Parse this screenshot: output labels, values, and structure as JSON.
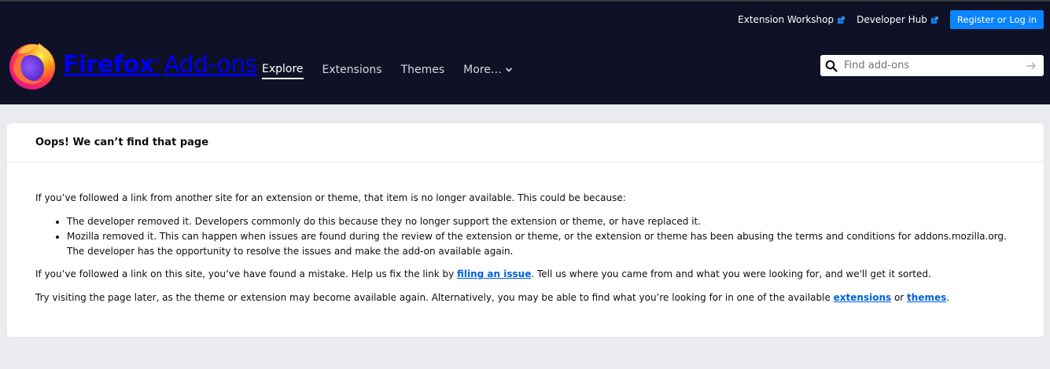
{
  "header": {
    "top_links": [
      {
        "label": "Extension Workshop",
        "icon": "external-link-icon"
      },
      {
        "label": "Developer Hub",
        "icon": "external-link-icon"
      }
    ],
    "register_label": "Register or Log in",
    "logo": {
      "brand": "Firefox",
      "trademark": "®",
      "product": "Add-ons"
    },
    "nav": [
      {
        "label": "Explore",
        "active": true
      },
      {
        "label": "Extensions",
        "active": false
      },
      {
        "label": "Themes",
        "active": false
      },
      {
        "label": "More…",
        "active": false
      }
    ],
    "search": {
      "placeholder": "Find add-ons",
      "value": ""
    }
  },
  "card": {
    "title": "Oops! We can’t find that page",
    "intro": "If you’ve followed a link from another site for an extension or theme, that item is no longer available. This could be because:",
    "reasons": [
      "The developer removed it. Developers commonly do this because they no longer support the extension or theme, or have replaced it.",
      "Mozilla removed it. This can happen when issues are found during the review of the extension or theme, or the extension or theme has been abusing the terms and conditions for addons.mozilla.org. The developer has the opportunity to resolve the issues and make the add-on available again."
    ],
    "para2": {
      "before": "If you’ve followed a link on this site, you’ve have found a mistake. Help us fix the link by ",
      "link": "filing an issue",
      "after": ". Tell us where you came from and what you were looking for, and we'll get it sorted."
    },
    "para3": {
      "before": "Try visiting the page later, as the theme or extension may become available again. Alternatively, you may be able to find what you’re looking for in one of the available ",
      "link1": "extensions",
      "middle": " or ",
      "link2": "themes",
      "after": "."
    }
  },
  "colors": {
    "header_bg": "#0f1126",
    "page_bg": "#e9ebee",
    "accent": "#0a84ff",
    "link": "#0060df"
  }
}
